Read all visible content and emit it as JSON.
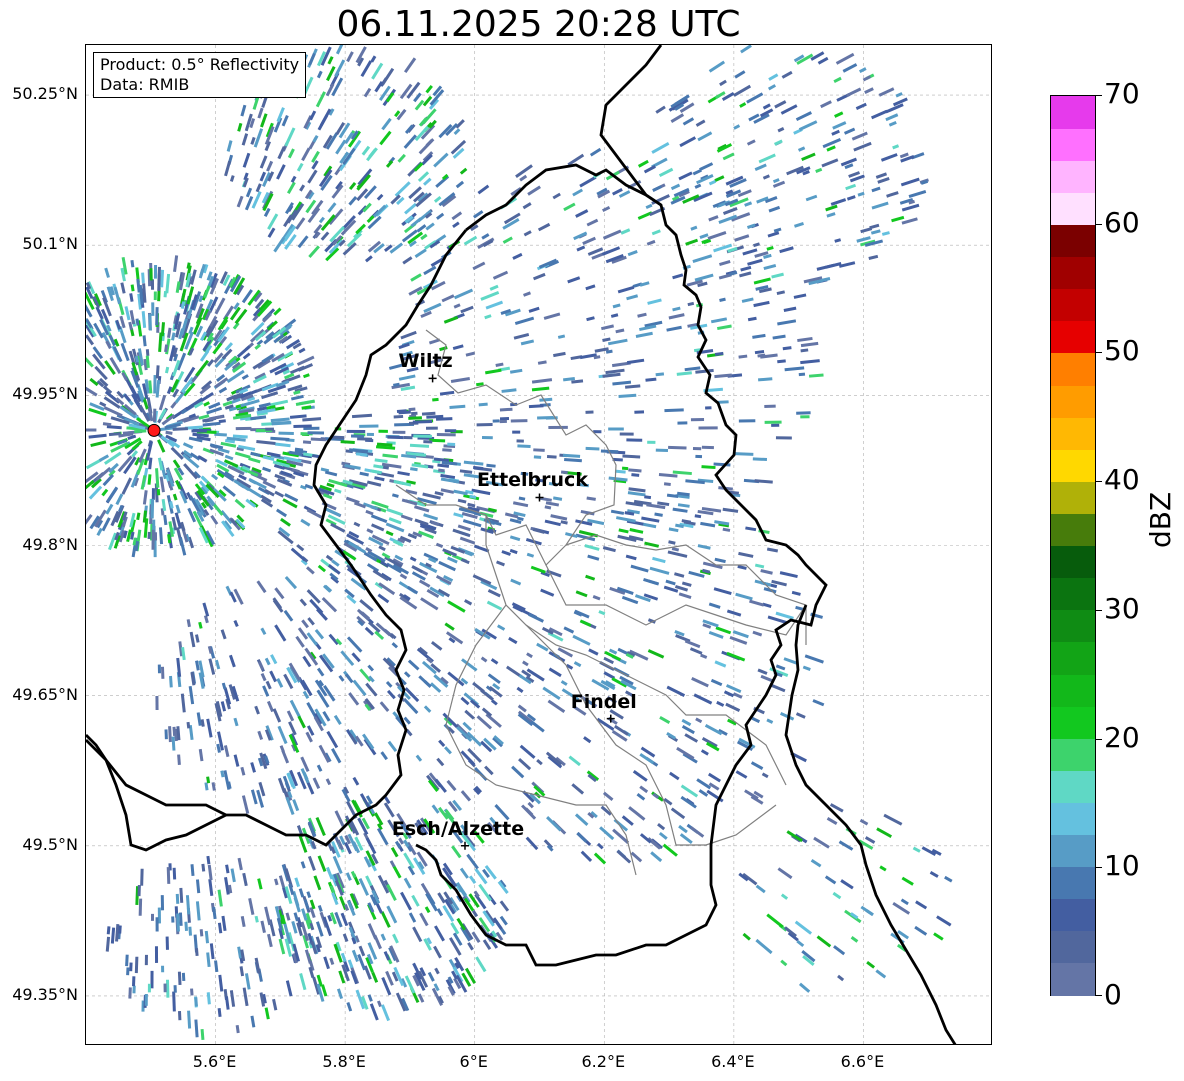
{
  "title": "06.11.2025 20:28 UTC",
  "info_box": {
    "product": "Product: 0.5° Reflectivity",
    "data_source": "Data: RMIB"
  },
  "lat_ticks": [
    "50.25°N",
    "50.1°N",
    "49.95°N",
    "49.8°N",
    "49.65°N",
    "49.5°N",
    "49.35°N"
  ],
  "lon_ticks": [
    "5.6°E",
    "5.8°E",
    "6°E",
    "6.2°E",
    "6.4°E",
    "6.6°E"
  ],
  "cities": [
    {
      "name": "Wiltz",
      "lon": 5.935,
      "lat": 49.967
    },
    {
      "name": "Ettelbruck",
      "lon": 6.1,
      "lat": 49.848
    },
    {
      "name": "Findel",
      "lon": 6.21,
      "lat": 49.627
    },
    {
      "name": "Esch/Alzette",
      "lon": 5.985,
      "lat": 49.5
    }
  ],
  "radar_site": {
    "lon": 5.505,
    "lat": 49.915,
    "color": "#ff1a1a"
  },
  "map_extent": {
    "lon_min": 5.4,
    "lon_max": 6.8,
    "lat_min": 49.3,
    "lat_max": 50.3
  },
  "colorbar": {
    "unit": "dBZ",
    "vmin": 0,
    "vmax": 70,
    "tick_labels": [
      "0",
      "10",
      "20",
      "30",
      "40",
      "50",
      "60",
      "70"
    ],
    "colors": [
      "#6475a6",
      "#51679d",
      "#435ea1",
      "#4878b0",
      "#579cc6",
      "#64c1df",
      "#5fd8c5",
      "#3dd36c",
      "#12c81f",
      "#12b81a",
      "#12a416",
      "#0f8c14",
      "#0b7410",
      "#075c0c",
      "#477c0b",
      "#b0b108",
      "#ffd800",
      "#ffb803",
      "#ff9c00",
      "#ff7f00",
      "#e60000",
      "#c30000",
      "#a00000",
      "#7b0000",
      "#ffe0ff",
      "#ffb4ff",
      "#ff70ff",
      "#e63aec"
    ]
  },
  "colors": {
    "border": "#000000",
    "canton": "#808080",
    "grid": "#b0b0b0"
  }
}
